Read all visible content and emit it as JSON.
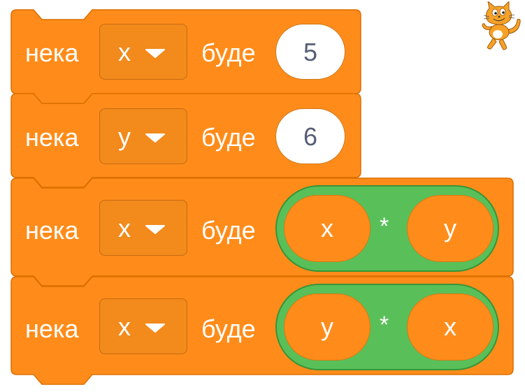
{
  "sprite": {
    "icon": "scratch-cat-icon"
  },
  "blocks": [
    {
      "keyword": "нека",
      "variable": "x",
      "to": "буде",
      "value": "5"
    },
    {
      "keyword": "нека",
      "variable": "y",
      "to": "буде",
      "value": "6"
    },
    {
      "keyword": "нека",
      "variable": "x",
      "to": "буде",
      "operation": {
        "left": "x",
        "operator": "*",
        "right": "y"
      }
    },
    {
      "keyword": "нека",
      "variable": "x",
      "to": "буде",
      "operation": {
        "left": "y",
        "operator": "*",
        "right": "x"
      }
    }
  ],
  "colors": {
    "variables_block": "#ff8c1a",
    "variables_border": "#db6e00",
    "operator_block": "#59c059",
    "operator_border": "#389438",
    "number_text": "#575e75"
  }
}
